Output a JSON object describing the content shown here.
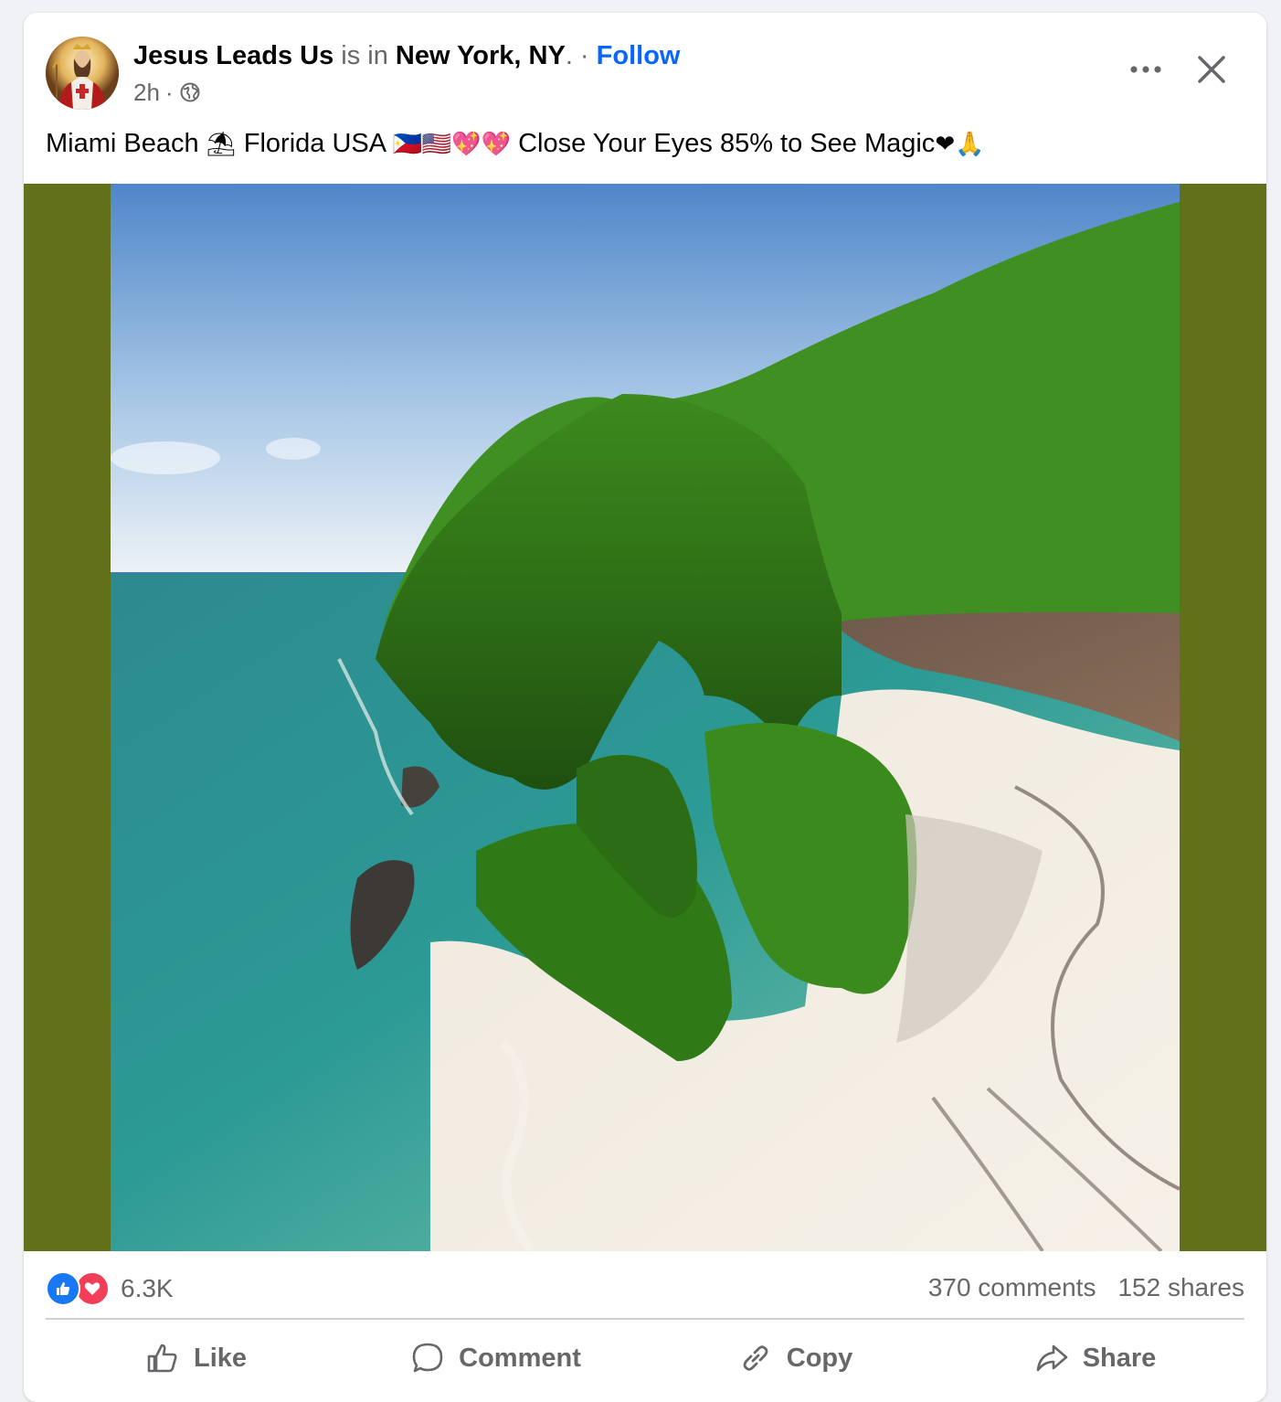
{
  "post": {
    "author": "Jesus Leads Us",
    "is_in_text": " is in ",
    "location": "New York, NY",
    "location_suffix": ".",
    "separator": " · ",
    "follow_label": "Follow",
    "time": "2h",
    "time_separator": "·",
    "audience_icon": "globe-icon",
    "caption_parts": {
      "part1": "Miami Beach ",
      "emoji_umbrella": "⛱",
      "part2": " Florida USA ",
      "emoji_flags_hearts": "🇵🇭🇺🇸💖💖",
      "part3": " Close Your Eyes 85% to See Magic",
      "emoji_end": "❤🙏"
    },
    "media_description_alt": ""
  },
  "stats": {
    "reaction_icons": [
      "like-reaction-icon",
      "love-reaction-icon"
    ],
    "reaction_count": "6.3K",
    "comments": "370 comments",
    "shares": "152 shares"
  },
  "actions": {
    "like": "Like",
    "comment": "Comment",
    "copy": "Copy",
    "share": "Share"
  },
  "colors": {
    "accent": "#0866ff",
    "media_background": "#627119",
    "like_blue": "#1877f2",
    "love_red": "#f33e58",
    "muted_text": "#65676b"
  }
}
